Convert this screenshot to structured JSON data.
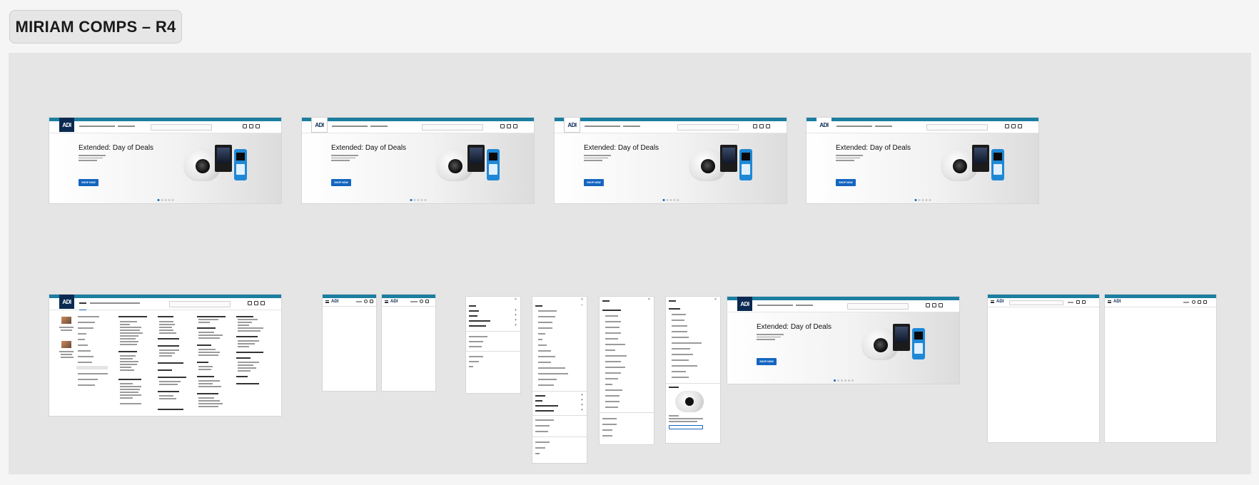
{
  "board": {
    "title": "MIRIAM COMPS – R4"
  },
  "desktop_frames": [
    {
      "logo": "ADI",
      "logo_style": "dark",
      "hero_title": "Extended: Day of Deals",
      "cta": "SHOP NOW"
    },
    {
      "logo": "ADI",
      "logo_style": "white",
      "hero_title": "Extended: Day of Deals",
      "cta": "SHOP NOW"
    },
    {
      "logo": "ADI",
      "logo_style": "white",
      "hero_title": "Extended: Day of Deals",
      "cta": "SHOP NOW"
    },
    {
      "logo": "ADI",
      "logo_style": "white-plain",
      "hero_title": "Extended: Day of Deals",
      "cta": "SHOP NOW"
    }
  ],
  "mega_menu_frame": {
    "logo": "ADI",
    "nav_active": "SHOP"
  },
  "mobile_frames": {
    "logo": "ADI"
  },
  "tablet_frame": {
    "logo": "ADI",
    "hero_title": "Extended: Day of Deals",
    "cta": "SHOP NOW"
  },
  "colors": {
    "promo_bar": "#1c7ea0",
    "brand_navy": "#0b2a52",
    "cta_blue": "#1565c0",
    "canvas_bg": "#e5e5e5"
  }
}
